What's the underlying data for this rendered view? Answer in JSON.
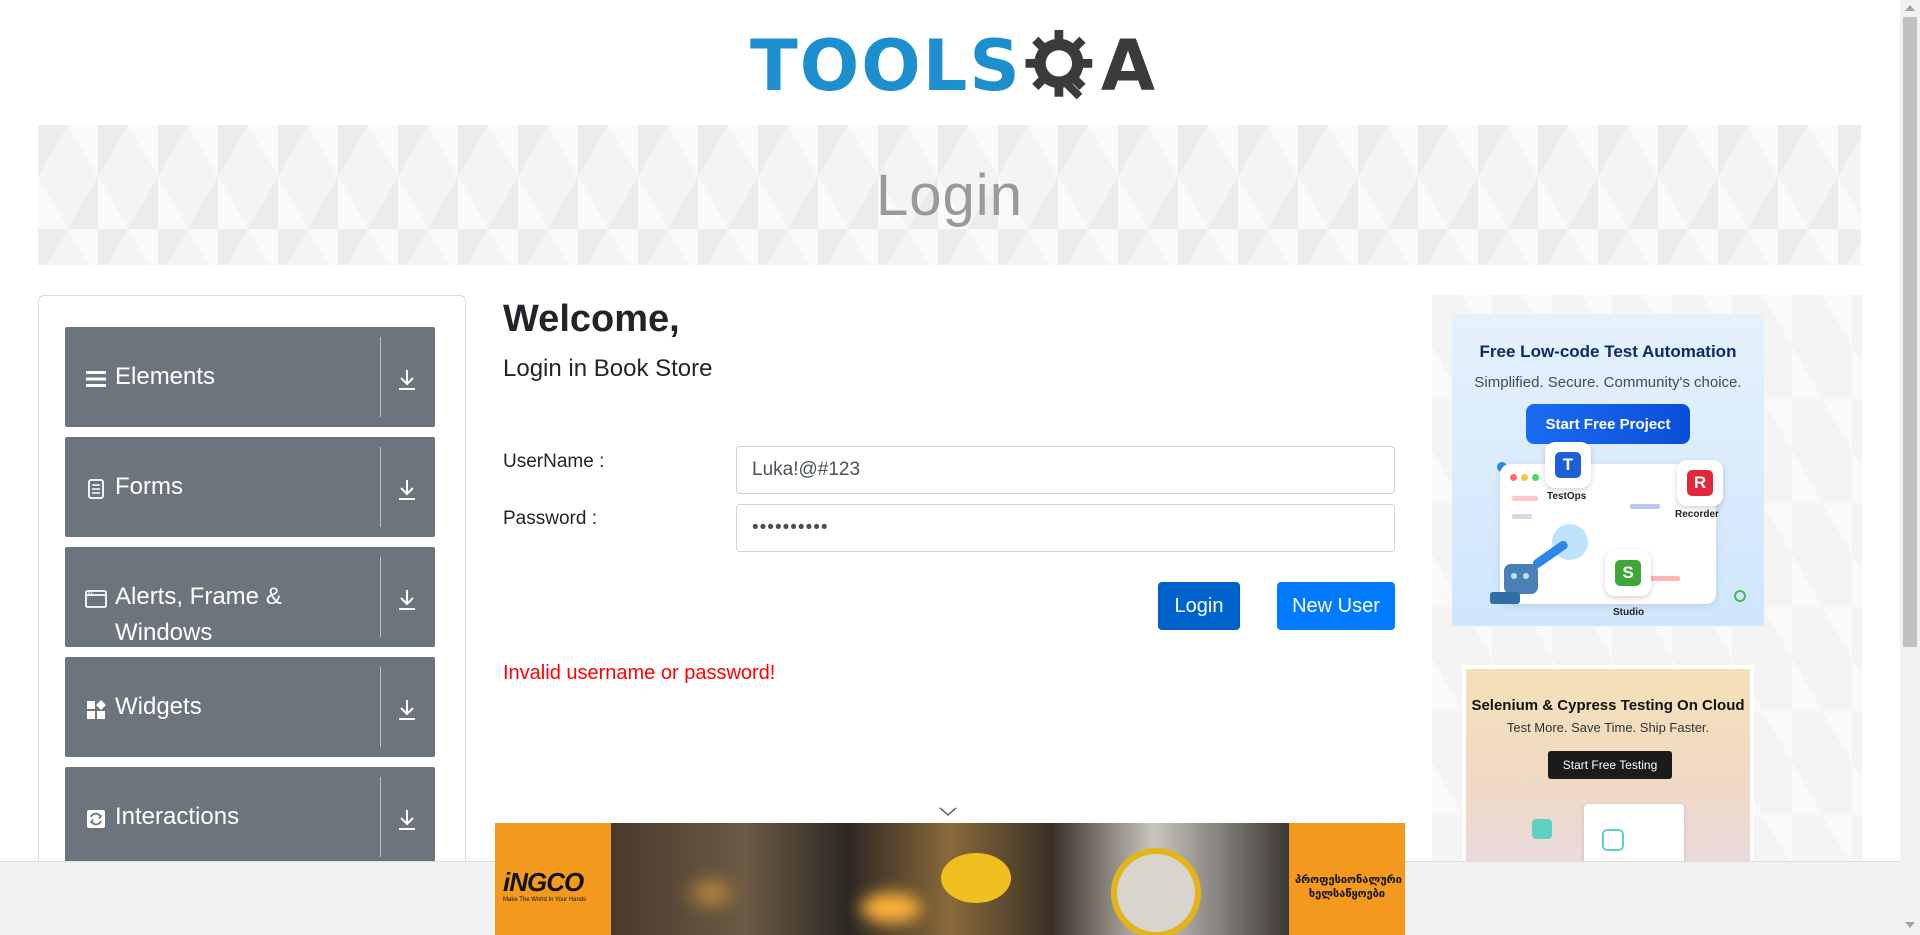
{
  "header": {
    "logo_text_left": "TOOLS",
    "logo_text_right": "A"
  },
  "banner": {
    "title": "Login"
  },
  "sidebar": {
    "groups": [
      {
        "label": "Elements",
        "icon": "hamburger-icon"
      },
      {
        "label": "Forms",
        "icon": "document-icon"
      },
      {
        "label": "Alerts, Frame & Windows",
        "icon": "window-icon"
      },
      {
        "label": "Widgets",
        "icon": "widgets-icon"
      },
      {
        "label": "Interactions",
        "icon": "interactions-icon"
      }
    ],
    "expand_icon": "download-arrow-icon"
  },
  "main": {
    "welcome": "Welcome,",
    "subtitle": "Login in Book Store",
    "username_label": "UserName :",
    "username_value": "Luka!@#123",
    "password_label": "Password :",
    "password_value": "••••••••••",
    "login_button": "Login",
    "new_user_button": "New User",
    "error_message": "Invalid username or password!"
  },
  "ads": {
    "ad1": {
      "title": "Free Low-code Test Automation",
      "subtitle": "Simplified. Secure. Community's choice.",
      "button": "Start Free Project",
      "apps": [
        {
          "name": "TestOps",
          "letter": "T",
          "color": "#1d5fd9"
        },
        {
          "name": "Recorder",
          "letter": "R",
          "color": "#e0283a"
        },
        {
          "name": "Studio",
          "letter": "S",
          "color": "#3fa63c"
        }
      ]
    },
    "ad2": {
      "title": "Selenium & Cypress Testing On Cloud",
      "subtitle": "Test More. Save Time. Ship Faster.",
      "button": "Start Free Testing"
    },
    "bottom": {
      "brand": "iNGCO",
      "tagline": "Make The World In Your Hands",
      "right_text": "პროფესიონალური ხელსაწყოები"
    }
  },
  "colors": {
    "sidebar_group": "#6c757d",
    "login_button": "#0062cc",
    "new_user_button": "#007bff",
    "error": "#ff0000",
    "logo_blue": "#1d8fcf",
    "ingco_orange": "#f39a1e"
  }
}
